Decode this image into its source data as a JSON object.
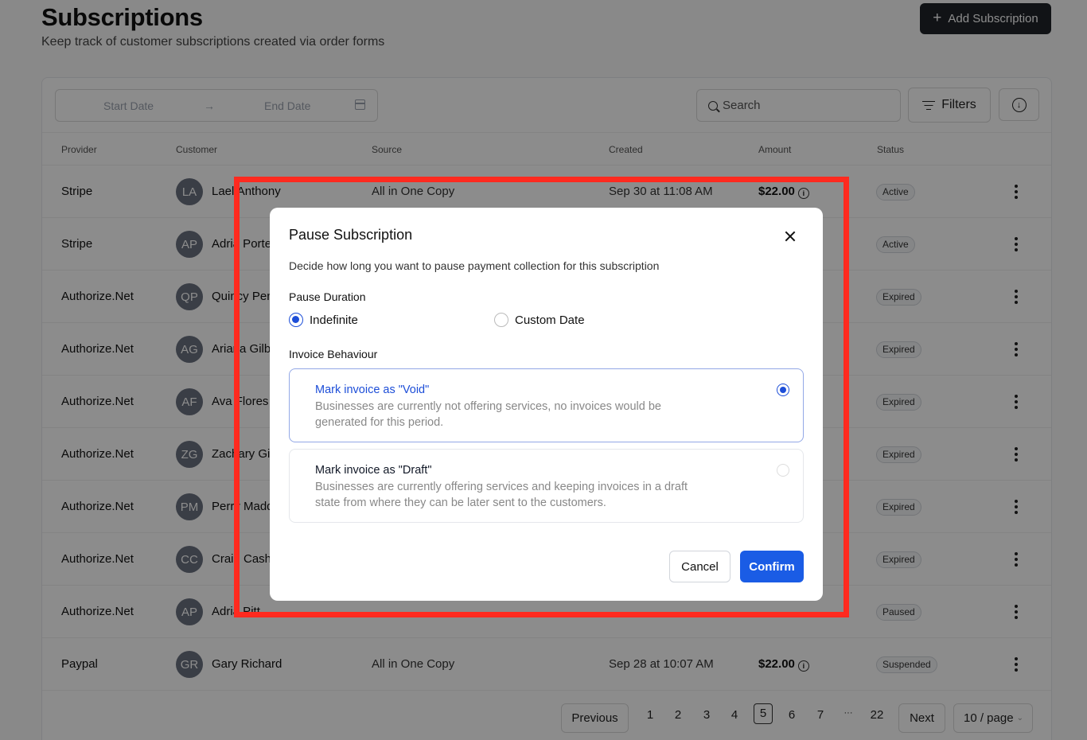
{
  "header": {
    "title": "Subscriptions",
    "subtitle": "Keep track of customer subscriptions created via order forms",
    "add_button": "Add Subscription"
  },
  "toolbar": {
    "start_date_placeholder": "Start Date",
    "end_date_placeholder": "End Date",
    "search_placeholder": "Search",
    "filters_label": "Filters"
  },
  "table": {
    "columns": [
      "Provider",
      "Customer",
      "Source",
      "Created",
      "Amount",
      "Status"
    ],
    "rows": [
      {
        "provider": "Stripe",
        "initials": "LA",
        "customer": "Lael Anthony",
        "source": "All in One Copy",
        "created": "Sep 30 at 11:08 AM",
        "amount": "$22.00",
        "status": "Active"
      },
      {
        "provider": "Stripe",
        "initials": "AP",
        "customer": "Adria Porter",
        "source": "",
        "created": "",
        "amount": "",
        "status": "Active"
      },
      {
        "provider": "Authorize.Net",
        "initials": "QP",
        "customer": "Quincy Pen",
        "source": "",
        "created": "",
        "amount": "",
        "status": "Expired"
      },
      {
        "provider": "Authorize.Net",
        "initials": "AG",
        "customer": "Ariana Gilbe",
        "source": "",
        "created": "",
        "amount": "",
        "status": "Expired"
      },
      {
        "provider": "Authorize.Net",
        "initials": "AF",
        "customer": "Ava Flores",
        "source": "",
        "created": "",
        "amount": "",
        "status": "Expired"
      },
      {
        "provider": "Authorize.Net",
        "initials": "ZG",
        "customer": "Zachary Gil",
        "source": "",
        "created": "",
        "amount": "",
        "status": "Expired"
      },
      {
        "provider": "Authorize.Net",
        "initials": "PM",
        "customer": "Perry Madd",
        "source": "",
        "created": "",
        "amount": "",
        "status": "Expired"
      },
      {
        "provider": "Authorize.Net",
        "initials": "CC",
        "customer": "Craig Cash",
        "source": "",
        "created": "",
        "amount": "",
        "status": "Expired"
      },
      {
        "provider": "Authorize.Net",
        "initials": "AP",
        "customer": "Adria Pitt",
        "source": "",
        "created": "",
        "amount": "",
        "status": "Paused"
      },
      {
        "provider": "Paypal",
        "initials": "GR",
        "customer": "Gary Richard",
        "source": "All in One Copy",
        "created": "Sep 28 at 10:07 AM",
        "amount": "$22.00",
        "status": "Suspended"
      }
    ]
  },
  "pagination": {
    "previous": "Previous",
    "next": "Next",
    "pages": [
      "1",
      "2",
      "3",
      "4",
      "5",
      "6",
      "7",
      "···",
      "22"
    ],
    "current": "5",
    "page_size": "10 / page"
  },
  "modal": {
    "title": "Pause Subscription",
    "description": "Decide how long you want to pause payment collection for this subscription",
    "duration_label": "Pause Duration",
    "duration_options": [
      "Indefinite",
      "Custom Date"
    ],
    "duration_selected": "Indefinite",
    "invoice_label": "Invoice Behaviour",
    "invoice_options": [
      {
        "title": "Mark invoice as \"Void\"",
        "description": "Businesses are currently not offering services, no invoices would be generated for this period.",
        "selected": true
      },
      {
        "title": "Mark invoice as \"Draft\"",
        "description": "Businesses are currently offering services and keeping invoices in a draft state from where they can be later sent to the customers.",
        "selected": false
      }
    ],
    "cancel_label": "Cancel",
    "confirm_label": "Confirm"
  },
  "colors": {
    "accent": "#1a5ce5",
    "highlight": "#ff2a1f",
    "dark_button": "#1f2328"
  }
}
